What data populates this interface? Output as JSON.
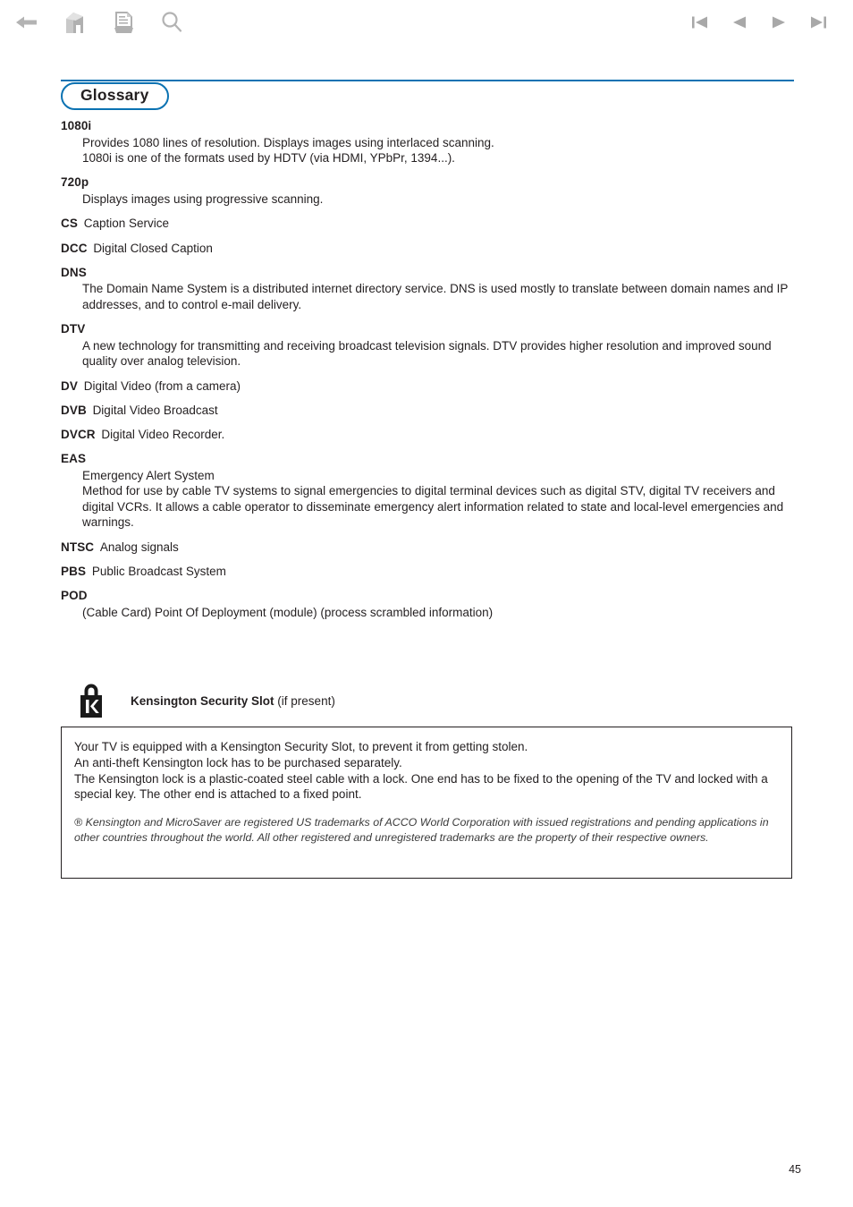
{
  "toolbar": {
    "left_buttons": [
      {
        "name": "back-icon",
        "label": "Back"
      },
      {
        "name": "home-icon",
        "label": "Home"
      },
      {
        "name": "print-icon",
        "label": "Print"
      },
      {
        "name": "search-icon",
        "label": "Search"
      }
    ],
    "right_buttons": [
      {
        "name": "first-page-icon",
        "label": "First page"
      },
      {
        "name": "previous-page-icon",
        "label": "Previous page"
      },
      {
        "name": "next-page-icon",
        "label": "Next page"
      },
      {
        "name": "last-page-icon",
        "label": "Last page"
      }
    ]
  },
  "header": {
    "title": "Glossary",
    "accent_color": "#0b72b2"
  },
  "glossary": {
    "entries": [
      {
        "term": "1080i",
        "layout": "block",
        "lines": [
          "Provides 1080 lines of resolution. Displays images using interlaced scanning.",
          "1080i is one of the formats used by HDTV (via HDMI, YPbPr, 1394...)."
        ]
      },
      {
        "term": "720p",
        "layout": "block",
        "lines": [
          "Displays images using progressive scanning."
        ]
      },
      {
        "term": "CS",
        "layout": "inline",
        "definition": "Caption Service"
      },
      {
        "term": "DCC",
        "layout": "inline",
        "definition": "Digital Closed Caption"
      },
      {
        "term": "DNS",
        "layout": "block",
        "lines": [
          "The Domain Name System is a distributed internet directory service. DNS is used mostly to translate between domain names and IP addresses, and to control e-mail delivery."
        ]
      },
      {
        "term": "DTV",
        "layout": "block",
        "lines": [
          "A new technology for transmitting and receiving broadcast television signals. DTV provides higher resolution and improved sound quality over analog television."
        ]
      },
      {
        "term": "DV",
        "layout": "inline",
        "definition": "Digital Video (from a camera)"
      },
      {
        "term": "DVB",
        "layout": "inline",
        "definition": "Digital Video Broadcast"
      },
      {
        "term": "DVCR",
        "layout": "inline",
        "definition": "Digital Video Recorder."
      },
      {
        "term": "EAS",
        "layout": "block",
        "lines": [
          "Emergency Alert System",
          "Method for use by cable TV systems to signal emergencies to digital terminal devices such as digital STV, digital TV receivers and digital VCRs. It allows a cable operator to disseminate emergency alert information related to state and local-level emergencies and warnings."
        ]
      },
      {
        "term": "NTSC",
        "layout": "inline",
        "definition": "Analog signals"
      },
      {
        "term": "PBS",
        "layout": "inline",
        "definition": "Public Broadcast System"
      },
      {
        "term": "POD",
        "layout": "block",
        "lines": [
          "(Cable Card) Point Of Deployment (module) (process scrambled information)"
        ]
      }
    ]
  },
  "kensington": {
    "icon_name": "kensington-lock-icon",
    "title_strong": "Kensington Security Slot",
    "title_note": "(if present)",
    "body_lines": [
      "Your TV is equipped with a Kensington Security Slot, to prevent it from getting stolen.",
      "An anti-theft Kensington lock has to be purchased separately.",
      "The Kensington lock is a plastic-coated steel cable with a lock. One end has to be fixed to the opening of the TV and locked with a special key. The other end is attached to a fixed point."
    ],
    "legal": "® Kensington and MicroSaver are registered US trademarks of ACCO World Corporation with issued registrations and pending applications in other countries throughout the world. All other registered and unregistered trademarks are the property of their respective owners."
  },
  "footer": {
    "page_number": "45"
  }
}
